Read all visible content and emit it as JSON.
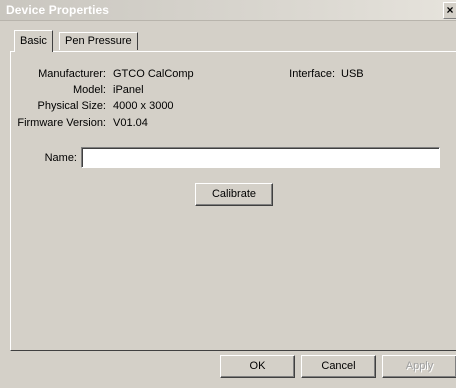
{
  "window": {
    "title": "Device Properties",
    "close_label": "×"
  },
  "tabs": [
    {
      "label": "Basic",
      "active": true
    },
    {
      "label": "Pen Pressure",
      "active": false
    }
  ],
  "device": {
    "manufacturer_label": "Manufacturer:",
    "manufacturer_value": "GTCO CalComp",
    "model_label": "Model:",
    "model_value": "iPanel",
    "size_label": "Physical Size:",
    "size_value": "4000 x 3000",
    "firmware_label": "Firmware Version:",
    "firmware_value": "V01.04",
    "interface_label": "Interface:",
    "interface_value": "USB"
  },
  "name_field": {
    "label": "Name:",
    "value": ""
  },
  "calibrate_label": "Calibrate",
  "footer": {
    "ok_label": "OK",
    "cancel_label": "Cancel",
    "apply_label": "Apply"
  }
}
